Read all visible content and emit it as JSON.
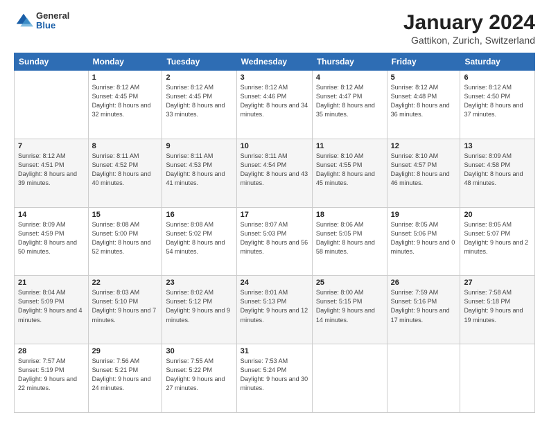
{
  "header": {
    "logo": {
      "general": "General",
      "blue": "Blue"
    },
    "title": "January 2024",
    "location": "Gattikon, Zurich, Switzerland"
  },
  "days_of_week": [
    "Sunday",
    "Monday",
    "Tuesday",
    "Wednesday",
    "Thursday",
    "Friday",
    "Saturday"
  ],
  "weeks": [
    [
      {
        "day": "",
        "sunrise": "",
        "sunset": "",
        "daylight": ""
      },
      {
        "day": "1",
        "sunrise": "Sunrise: 8:12 AM",
        "sunset": "Sunset: 4:45 PM",
        "daylight": "Daylight: 8 hours and 32 minutes."
      },
      {
        "day": "2",
        "sunrise": "Sunrise: 8:12 AM",
        "sunset": "Sunset: 4:45 PM",
        "daylight": "Daylight: 8 hours and 33 minutes."
      },
      {
        "day": "3",
        "sunrise": "Sunrise: 8:12 AM",
        "sunset": "Sunset: 4:46 PM",
        "daylight": "Daylight: 8 hours and 34 minutes."
      },
      {
        "day": "4",
        "sunrise": "Sunrise: 8:12 AM",
        "sunset": "Sunset: 4:47 PM",
        "daylight": "Daylight: 8 hours and 35 minutes."
      },
      {
        "day": "5",
        "sunrise": "Sunrise: 8:12 AM",
        "sunset": "Sunset: 4:48 PM",
        "daylight": "Daylight: 8 hours and 36 minutes."
      },
      {
        "day": "6",
        "sunrise": "Sunrise: 8:12 AM",
        "sunset": "Sunset: 4:50 PM",
        "daylight": "Daylight: 8 hours and 37 minutes."
      }
    ],
    [
      {
        "day": "7",
        "sunrise": "Sunrise: 8:12 AM",
        "sunset": "Sunset: 4:51 PM",
        "daylight": "Daylight: 8 hours and 39 minutes."
      },
      {
        "day": "8",
        "sunrise": "Sunrise: 8:11 AM",
        "sunset": "Sunset: 4:52 PM",
        "daylight": "Daylight: 8 hours and 40 minutes."
      },
      {
        "day": "9",
        "sunrise": "Sunrise: 8:11 AM",
        "sunset": "Sunset: 4:53 PM",
        "daylight": "Daylight: 8 hours and 41 minutes."
      },
      {
        "day": "10",
        "sunrise": "Sunrise: 8:11 AM",
        "sunset": "Sunset: 4:54 PM",
        "daylight": "Daylight: 8 hours and 43 minutes."
      },
      {
        "day": "11",
        "sunrise": "Sunrise: 8:10 AM",
        "sunset": "Sunset: 4:55 PM",
        "daylight": "Daylight: 8 hours and 45 minutes."
      },
      {
        "day": "12",
        "sunrise": "Sunrise: 8:10 AM",
        "sunset": "Sunset: 4:57 PM",
        "daylight": "Daylight: 8 hours and 46 minutes."
      },
      {
        "day": "13",
        "sunrise": "Sunrise: 8:09 AM",
        "sunset": "Sunset: 4:58 PM",
        "daylight": "Daylight: 8 hours and 48 minutes."
      }
    ],
    [
      {
        "day": "14",
        "sunrise": "Sunrise: 8:09 AM",
        "sunset": "Sunset: 4:59 PM",
        "daylight": "Daylight: 8 hours and 50 minutes."
      },
      {
        "day": "15",
        "sunrise": "Sunrise: 8:08 AM",
        "sunset": "Sunset: 5:00 PM",
        "daylight": "Daylight: 8 hours and 52 minutes."
      },
      {
        "day": "16",
        "sunrise": "Sunrise: 8:08 AM",
        "sunset": "Sunset: 5:02 PM",
        "daylight": "Daylight: 8 hours and 54 minutes."
      },
      {
        "day": "17",
        "sunrise": "Sunrise: 8:07 AM",
        "sunset": "Sunset: 5:03 PM",
        "daylight": "Daylight: 8 hours and 56 minutes."
      },
      {
        "day": "18",
        "sunrise": "Sunrise: 8:06 AM",
        "sunset": "Sunset: 5:05 PM",
        "daylight": "Daylight: 8 hours and 58 minutes."
      },
      {
        "day": "19",
        "sunrise": "Sunrise: 8:05 AM",
        "sunset": "Sunset: 5:06 PM",
        "daylight": "Daylight: 9 hours and 0 minutes."
      },
      {
        "day": "20",
        "sunrise": "Sunrise: 8:05 AM",
        "sunset": "Sunset: 5:07 PM",
        "daylight": "Daylight: 9 hours and 2 minutes."
      }
    ],
    [
      {
        "day": "21",
        "sunrise": "Sunrise: 8:04 AM",
        "sunset": "Sunset: 5:09 PM",
        "daylight": "Daylight: 9 hours and 4 minutes."
      },
      {
        "day": "22",
        "sunrise": "Sunrise: 8:03 AM",
        "sunset": "Sunset: 5:10 PM",
        "daylight": "Daylight: 9 hours and 7 minutes."
      },
      {
        "day": "23",
        "sunrise": "Sunrise: 8:02 AM",
        "sunset": "Sunset: 5:12 PM",
        "daylight": "Daylight: 9 hours and 9 minutes."
      },
      {
        "day": "24",
        "sunrise": "Sunrise: 8:01 AM",
        "sunset": "Sunset: 5:13 PM",
        "daylight": "Daylight: 9 hours and 12 minutes."
      },
      {
        "day": "25",
        "sunrise": "Sunrise: 8:00 AM",
        "sunset": "Sunset: 5:15 PM",
        "daylight": "Daylight: 9 hours and 14 minutes."
      },
      {
        "day": "26",
        "sunrise": "Sunrise: 7:59 AM",
        "sunset": "Sunset: 5:16 PM",
        "daylight": "Daylight: 9 hours and 17 minutes."
      },
      {
        "day": "27",
        "sunrise": "Sunrise: 7:58 AM",
        "sunset": "Sunset: 5:18 PM",
        "daylight": "Daylight: 9 hours and 19 minutes."
      }
    ],
    [
      {
        "day": "28",
        "sunrise": "Sunrise: 7:57 AM",
        "sunset": "Sunset: 5:19 PM",
        "daylight": "Daylight: 9 hours and 22 minutes."
      },
      {
        "day": "29",
        "sunrise": "Sunrise: 7:56 AM",
        "sunset": "Sunset: 5:21 PM",
        "daylight": "Daylight: 9 hours and 24 minutes."
      },
      {
        "day": "30",
        "sunrise": "Sunrise: 7:55 AM",
        "sunset": "Sunset: 5:22 PM",
        "daylight": "Daylight: 9 hours and 27 minutes."
      },
      {
        "day": "31",
        "sunrise": "Sunrise: 7:53 AM",
        "sunset": "Sunset: 5:24 PM",
        "daylight": "Daylight: 9 hours and 30 minutes."
      },
      {
        "day": "",
        "sunrise": "",
        "sunset": "",
        "daylight": ""
      },
      {
        "day": "",
        "sunrise": "",
        "sunset": "",
        "daylight": ""
      },
      {
        "day": "",
        "sunrise": "",
        "sunset": "",
        "daylight": ""
      }
    ]
  ]
}
